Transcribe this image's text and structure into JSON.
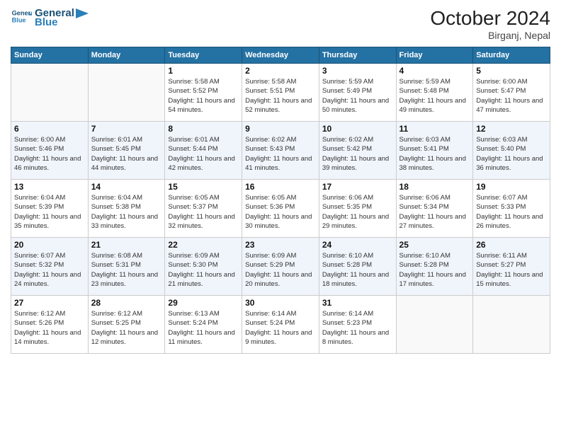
{
  "header": {
    "logo_line1": "General",
    "logo_line2": "Blue",
    "month_title": "October 2024",
    "location": "Birganj, Nepal"
  },
  "weekdays": [
    "Sunday",
    "Monday",
    "Tuesday",
    "Wednesday",
    "Thursday",
    "Friday",
    "Saturday"
  ],
  "weeks": [
    [
      {
        "day": "",
        "info": ""
      },
      {
        "day": "",
        "info": ""
      },
      {
        "day": "1",
        "info": "Sunrise: 5:58 AM\nSunset: 5:52 PM\nDaylight: 11 hours and 54 minutes."
      },
      {
        "day": "2",
        "info": "Sunrise: 5:58 AM\nSunset: 5:51 PM\nDaylight: 11 hours and 52 minutes."
      },
      {
        "day": "3",
        "info": "Sunrise: 5:59 AM\nSunset: 5:49 PM\nDaylight: 11 hours and 50 minutes."
      },
      {
        "day": "4",
        "info": "Sunrise: 5:59 AM\nSunset: 5:48 PM\nDaylight: 11 hours and 49 minutes."
      },
      {
        "day": "5",
        "info": "Sunrise: 6:00 AM\nSunset: 5:47 PM\nDaylight: 11 hours and 47 minutes."
      }
    ],
    [
      {
        "day": "6",
        "info": "Sunrise: 6:00 AM\nSunset: 5:46 PM\nDaylight: 11 hours and 46 minutes."
      },
      {
        "day": "7",
        "info": "Sunrise: 6:01 AM\nSunset: 5:45 PM\nDaylight: 11 hours and 44 minutes."
      },
      {
        "day": "8",
        "info": "Sunrise: 6:01 AM\nSunset: 5:44 PM\nDaylight: 11 hours and 42 minutes."
      },
      {
        "day": "9",
        "info": "Sunrise: 6:02 AM\nSunset: 5:43 PM\nDaylight: 11 hours and 41 minutes."
      },
      {
        "day": "10",
        "info": "Sunrise: 6:02 AM\nSunset: 5:42 PM\nDaylight: 11 hours and 39 minutes."
      },
      {
        "day": "11",
        "info": "Sunrise: 6:03 AM\nSunset: 5:41 PM\nDaylight: 11 hours and 38 minutes."
      },
      {
        "day": "12",
        "info": "Sunrise: 6:03 AM\nSunset: 5:40 PM\nDaylight: 11 hours and 36 minutes."
      }
    ],
    [
      {
        "day": "13",
        "info": "Sunrise: 6:04 AM\nSunset: 5:39 PM\nDaylight: 11 hours and 35 minutes."
      },
      {
        "day": "14",
        "info": "Sunrise: 6:04 AM\nSunset: 5:38 PM\nDaylight: 11 hours and 33 minutes."
      },
      {
        "day": "15",
        "info": "Sunrise: 6:05 AM\nSunset: 5:37 PM\nDaylight: 11 hours and 32 minutes."
      },
      {
        "day": "16",
        "info": "Sunrise: 6:05 AM\nSunset: 5:36 PM\nDaylight: 11 hours and 30 minutes."
      },
      {
        "day": "17",
        "info": "Sunrise: 6:06 AM\nSunset: 5:35 PM\nDaylight: 11 hours and 29 minutes."
      },
      {
        "day": "18",
        "info": "Sunrise: 6:06 AM\nSunset: 5:34 PM\nDaylight: 11 hours and 27 minutes."
      },
      {
        "day": "19",
        "info": "Sunrise: 6:07 AM\nSunset: 5:33 PM\nDaylight: 11 hours and 26 minutes."
      }
    ],
    [
      {
        "day": "20",
        "info": "Sunrise: 6:07 AM\nSunset: 5:32 PM\nDaylight: 11 hours and 24 minutes."
      },
      {
        "day": "21",
        "info": "Sunrise: 6:08 AM\nSunset: 5:31 PM\nDaylight: 11 hours and 23 minutes."
      },
      {
        "day": "22",
        "info": "Sunrise: 6:09 AM\nSunset: 5:30 PM\nDaylight: 11 hours and 21 minutes."
      },
      {
        "day": "23",
        "info": "Sunrise: 6:09 AM\nSunset: 5:29 PM\nDaylight: 11 hours and 20 minutes."
      },
      {
        "day": "24",
        "info": "Sunrise: 6:10 AM\nSunset: 5:28 PM\nDaylight: 11 hours and 18 minutes."
      },
      {
        "day": "25",
        "info": "Sunrise: 6:10 AM\nSunset: 5:28 PM\nDaylight: 11 hours and 17 minutes."
      },
      {
        "day": "26",
        "info": "Sunrise: 6:11 AM\nSunset: 5:27 PM\nDaylight: 11 hours and 15 minutes."
      }
    ],
    [
      {
        "day": "27",
        "info": "Sunrise: 6:12 AM\nSunset: 5:26 PM\nDaylight: 11 hours and 14 minutes."
      },
      {
        "day": "28",
        "info": "Sunrise: 6:12 AM\nSunset: 5:25 PM\nDaylight: 11 hours and 12 minutes."
      },
      {
        "day": "29",
        "info": "Sunrise: 6:13 AM\nSunset: 5:24 PM\nDaylight: 11 hours and 11 minutes."
      },
      {
        "day": "30",
        "info": "Sunrise: 6:14 AM\nSunset: 5:24 PM\nDaylight: 11 hours and 9 minutes."
      },
      {
        "day": "31",
        "info": "Sunrise: 6:14 AM\nSunset: 5:23 PM\nDaylight: 11 hours and 8 minutes."
      },
      {
        "day": "",
        "info": ""
      },
      {
        "day": "",
        "info": ""
      }
    ]
  ]
}
